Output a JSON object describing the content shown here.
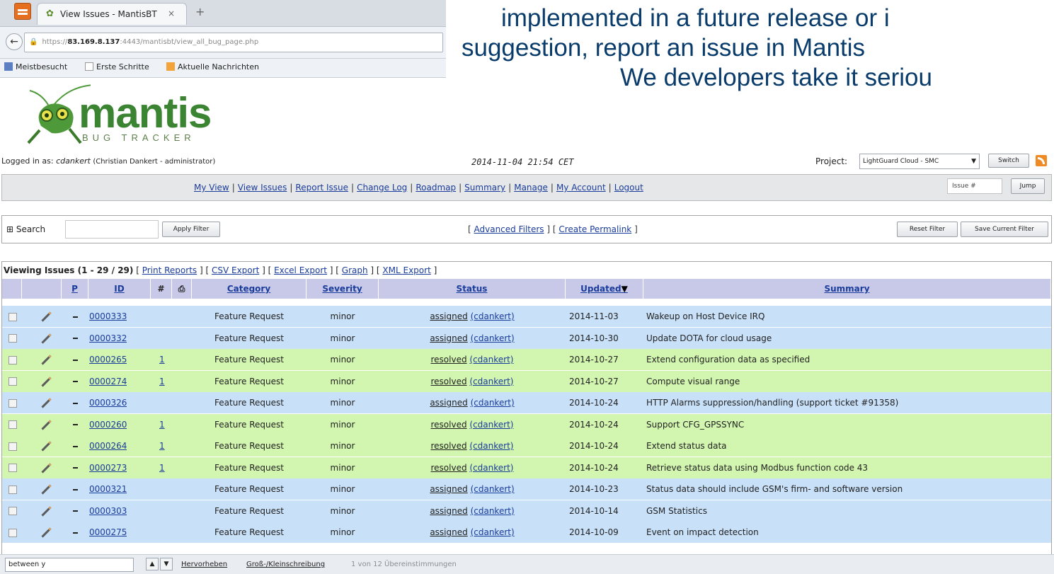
{
  "browser": {
    "tab_title": "View Issues - MantisBT",
    "tab_close": "×",
    "new_tab": "+",
    "url_prefix": "https://",
    "url_host": "83.169.8.137",
    "url_rest": ":4443/mantisbt/view_all_bug_page.php",
    "bookmarks": [
      "Meistbesucht",
      "Erste Schritte",
      "Aktuelle Nachrichten"
    ]
  },
  "slide": {
    "line1": "implemented in a future release or i",
    "line2": "suggestion, report an issue in Mantis",
    "line3": "We developers take it seriou"
  },
  "logo": {
    "name": "mantis",
    "subtitle": "BUG TRACKER"
  },
  "header": {
    "logged_in_label": "Logged in as:",
    "username": "cdankert",
    "user_detail": "(Christian Dankert - administrator)",
    "datetime": "2014-11-04 21:54 CET",
    "project_label": "Project:",
    "project_value": "LightGuard Cloud - SMC",
    "switch_label": "Switch"
  },
  "menu": {
    "items": [
      "My View",
      "View Issues",
      "Report Issue",
      "Change Log",
      "Roadmap",
      "Summary",
      "Manage",
      "My Account",
      "Logout"
    ],
    "issue_placeholder": "Issue #",
    "jump_label": "Jump"
  },
  "search": {
    "label": "⊞ Search",
    "apply_label": "Apply Filter",
    "advanced": "Advanced Filters",
    "permalink": "Create Permalink",
    "reset_label": "Reset Filter",
    "save_label": "Save Current Filter"
  },
  "viewing": {
    "label": "Viewing Issues (1 - 29 / 29)",
    "links": [
      "Print Reports",
      "CSV Export",
      "Excel Export",
      "Graph",
      "XML Export"
    ]
  },
  "columns": [
    "P",
    "ID",
    "#",
    "Category",
    "Severity",
    "Status",
    "Updated",
    "Summary"
  ],
  "sort_indicator": "▼",
  "colors": {
    "assigned": "#c8e0f8",
    "resolved": "#d2f5b0",
    "header": "#c8c8e8",
    "link": "#1a3c9a"
  },
  "issues": [
    {
      "id": "0000333",
      "notes": "",
      "category": "Feature Request",
      "severity": "minor",
      "status": "assigned",
      "handler": "(cdankert)",
      "updated": "2014-11-03",
      "summary": "Wakeup on Host Device IRQ"
    },
    {
      "id": "0000332",
      "notes": "",
      "category": "Feature Request",
      "severity": "minor",
      "status": "assigned",
      "handler": "(cdankert)",
      "updated": "2014-10-30",
      "summary": "Update DOTA for cloud usage"
    },
    {
      "id": "0000265",
      "notes": "1",
      "category": "Feature Request",
      "severity": "minor",
      "status": "resolved",
      "handler": "(cdankert)",
      "updated": "2014-10-27",
      "summary": "Extend configuration data as specified"
    },
    {
      "id": "0000274",
      "notes": "1",
      "category": "Feature Request",
      "severity": "minor",
      "status": "resolved",
      "handler": "(cdankert)",
      "updated": "2014-10-27",
      "summary": "Compute visual range"
    },
    {
      "id": "0000326",
      "notes": "",
      "category": "Feature Request",
      "severity": "minor",
      "status": "assigned",
      "handler": "(cdankert)",
      "updated": "2014-10-24",
      "summary": "HTTP Alarms suppression/handling (support ticket #91358)"
    },
    {
      "id": "0000260",
      "notes": "1",
      "category": "Feature Request",
      "severity": "minor",
      "status": "resolved",
      "handler": "(cdankert)",
      "updated": "2014-10-24",
      "summary": "Support CFG_GPSSYNC"
    },
    {
      "id": "0000264",
      "notes": "1",
      "category": "Feature Request",
      "severity": "minor",
      "status": "resolved",
      "handler": "(cdankert)",
      "updated": "2014-10-24",
      "summary": "Extend status data"
    },
    {
      "id": "0000273",
      "notes": "1",
      "category": "Feature Request",
      "severity": "minor",
      "status": "resolved",
      "handler": "(cdankert)",
      "updated": "2014-10-24",
      "summary": "Retrieve status data using Modbus function code 43"
    },
    {
      "id": "0000321",
      "notes": "",
      "category": "Feature Request",
      "severity": "minor",
      "status": "assigned",
      "handler": "(cdankert)",
      "updated": "2014-10-23",
      "summary": "Status data should include GSM's firm- and software version"
    },
    {
      "id": "0000303",
      "notes": "",
      "category": "Feature Request",
      "severity": "minor",
      "status": "assigned",
      "handler": "(cdankert)",
      "updated": "2014-10-14",
      "summary": "GSM Statistics"
    },
    {
      "id": "0000275",
      "notes": "",
      "category": "Feature Request",
      "severity": "minor",
      "status": "assigned",
      "handler": "(cdankert)",
      "updated": "2014-10-09",
      "summary": "Event on impact detection"
    }
  ],
  "findbar": {
    "query": "between y",
    "highlight": "Hervorheben",
    "matchcase": "Groß-/Kleinschreibung",
    "result": "1 von 12 Übereinstimmungen"
  }
}
